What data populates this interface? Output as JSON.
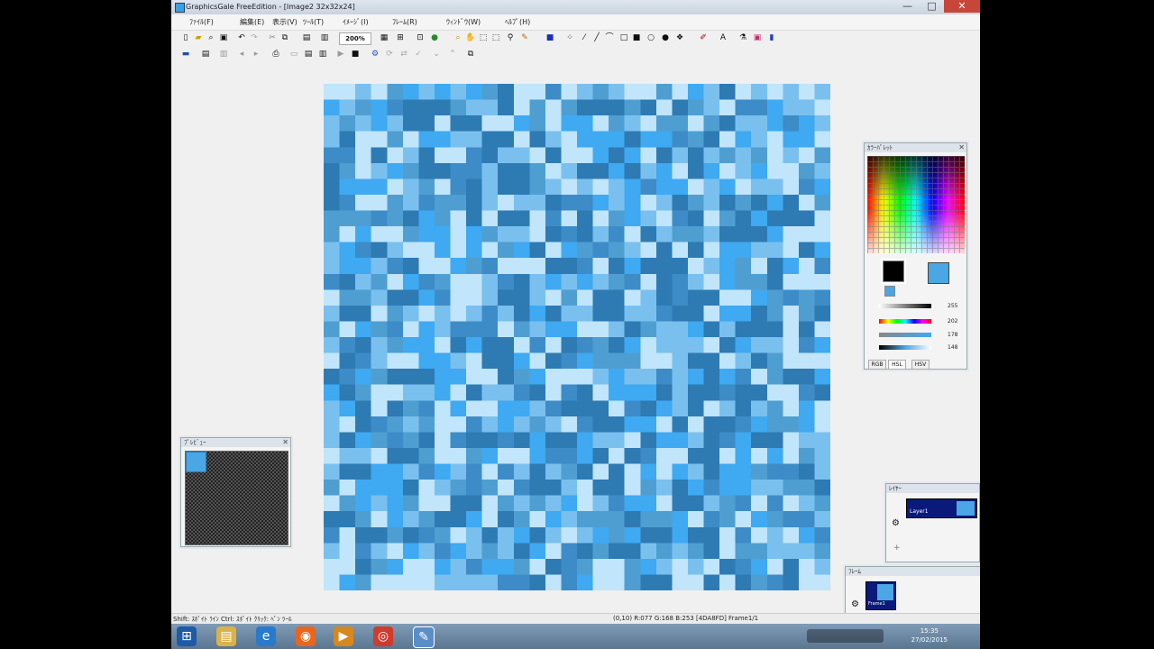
{
  "window": {
    "title": "GraphicsGale FreeEdition - [Image2 32x32x24]",
    "controls": {
      "minimize": "—",
      "maximize": "□",
      "close": "✕"
    }
  },
  "menu": [
    "ﾌｧｲﾙ(F)",
    "編集(E)",
    "表示(V)",
    "ﾂｰﾙ(T)",
    "ｲﾒｰｼﾞ(I)",
    "ﾌﾚｰﾑ(R)",
    "ｳｨﾝﾄﾞｳ(W)",
    "ﾍﾙﾌﾟ(H)"
  ],
  "toolbar": {
    "zoom_value": "200%",
    "row1_icons": [
      "new-icon",
      "open-icon",
      "search-icon",
      "save-icon",
      "undo-icon",
      "redo-icon",
      "cut-icon",
      "copy-icon",
      "paste-icon",
      "zoom-select-icon",
      "grid-icon",
      "grid2-icon",
      "color-icon",
      "zoom-icon",
      "hand-icon",
      "select-rect-icon",
      "select-lasso-icon",
      "magic-wand-icon",
      "pencil-icon",
      "fill-icon",
      "line-icon",
      "curve-icon",
      "rect-icon",
      "filled-rect-icon",
      "ellipse-icon",
      "filled-ellipse-icon",
      "spray-icon",
      "brush-icon",
      "text-icon",
      "eyedropper-icon",
      "palette-icon",
      "bottle-icon"
    ],
    "row2_icons": [
      "frame-icon",
      "layer-icon",
      "onion-icon",
      "prev-icon",
      "next-icon",
      "print-icon",
      "copy-frame-icon",
      "paste-frame-icon",
      "play-icon",
      "stop-icon",
      "gear-icon",
      "rotate-icon",
      "flip-icon",
      "arrow-down-icon",
      "arrow-up-icon",
      "export-icon"
    ]
  },
  "colors": {
    "palette": [
      "#c1e5fb",
      "#7ac0ee",
      "#3fa9f1",
      "#4f9ed2",
      "#2e7ab3",
      "#3d8cc7"
    ],
    "canvas_grid": "001032121234005013100302140101012132544431140303444340431055211013121440440023022031033034112521140030221144041022242253402102205504014005411040024204141313010343012344551443014424120420120031422201305414431010125220120110524500315334101145521201431434240333353423040440504032105403424440302003220231104541504133144420001254100202032402353104040221104212215400235000445042444012304205541302530015412121350451023340000331442500144103044014544002353514403101015142411441154402243034302350215550312200143112414440401541322042440504534201110421105204510022104420452333001440143000452344422004320001211512425034422430011204115405402224144544005412404350200221544405421401413020104531300512131054422040445233201423534054454244211042214524401101104430032002552404500440202031144221521505141340402021422355413022240135305441044031425221133403212300440313120152204413505013443021344204302133343320530235515044345301412410123244244050102510510215213142054344131340331113004320021522304530032101045204010230000111155405200344004043540002400424050414245500410415402444214254021014101",
    "foreground": "#000000",
    "background": "#4aa6e4"
  },
  "color_panel": {
    "title": "ｶﾗｰﾊﾟﾚｯﾄ",
    "sliders": [
      {
        "value": "255"
      },
      {
        "value": "202"
      },
      {
        "value": "178"
      },
      {
        "value": "148"
      }
    ],
    "tabs": [
      "RGB",
      "HSL",
      "HSV"
    ]
  },
  "preview_panel": {
    "title": "ﾌﾟﾚﾋﾞｭｰ"
  },
  "layers_panel": {
    "title": "ﾚｲﾔｰ",
    "item": "Layer1"
  },
  "frames_panel": {
    "title": "ﾌﾚｰﾑ",
    "item": "Frame1"
  },
  "status": {
    "left": "Shift: ｽﾎﾟｲﾄ ﾗｲﾝ  Ctrl: ｽﾎﾟｲﾄ  ｸﾘｯｸ: ﾍﾟﾝ ﾂｰﾙ",
    "right": "(0,10)  R:077 G:168 B:253  [4DA8FD]  Frame1/1"
  },
  "taskbar": {
    "time": "15:35",
    "date": "27/02/2015",
    "apps": [
      "start-icon",
      "explorer-icon",
      "ie-icon",
      "firefox-icon",
      "media-icon",
      "chrome-icon",
      "gale-icon"
    ]
  }
}
